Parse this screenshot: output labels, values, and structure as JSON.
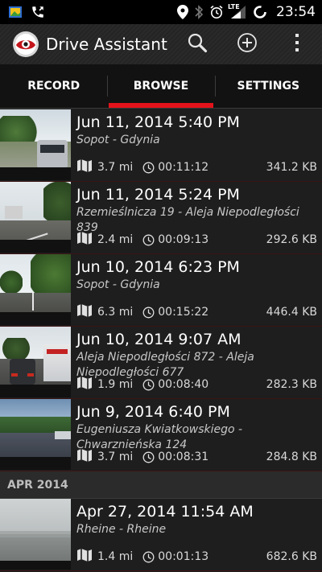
{
  "status_bar": {
    "time": "23:54",
    "left_icons": [
      "gallery-icon",
      "phone-icon"
    ],
    "right_icons": [
      "location-icon",
      "bluetooth-icon",
      "alarm-icon",
      "signal-lte-icon",
      "sync-icon"
    ],
    "lte_label": "LTE"
  },
  "app": {
    "title": "Drive Assistant",
    "actions": [
      "search-icon",
      "add-icon",
      "overflow-icon"
    ]
  },
  "tabs": [
    {
      "label": "RECORD",
      "active": false
    },
    {
      "label": "BROWSE",
      "active": true
    },
    {
      "label": "SETTINGS",
      "active": false
    }
  ],
  "recordings": [
    {
      "title": "Jun 11, 2014 5:40 PM",
      "route": "Sopot - Gdynia",
      "distance": "3.7 mi",
      "duration": "00:11:12",
      "size": "341.2 KB",
      "scene": "urban"
    },
    {
      "title": "Jun 11, 2014 5:24 PM",
      "route": "Rzemieślnicza 19 - Aleja Niepodległości 839",
      "distance": "2.4 mi",
      "duration": "00:09:13",
      "size": "292.6 KB",
      "scene": "suburb"
    },
    {
      "title": "Jun 10, 2014 6:23 PM",
      "route": "Sopot - Gdynia",
      "distance": "6.3 mi",
      "duration": "00:15:22",
      "size": "446.4 KB",
      "scene": "trees"
    },
    {
      "title": "Jun 10, 2014 9:07 AM",
      "route": "Aleja Niepodległości 872 - Aleja Niepodległości 677",
      "distance": "1.9 mi",
      "duration": "00:08:40",
      "size": "282.3 KB",
      "scene": "traffic"
    },
    {
      "title": "Jun 9, 2014 6:40 PM",
      "route": "Eugeniusza Kwiatkowskiego - Chwarznieńska 124",
      "distance": "3.7 mi",
      "duration": "00:08:31",
      "size": "284.8 KB",
      "scene": "highway"
    }
  ],
  "section_header": "APR 2014",
  "recordings_apr": [
    {
      "title": "Apr 27, 2014 11:54 AM",
      "route": "Rheine - Rheine",
      "distance": "1.4 mi",
      "duration": "00:01:13",
      "size": "682.6 KB",
      "scene": "rain"
    }
  ],
  "colors": {
    "accent": "#e4131b",
    "background": "#1e1e1e"
  }
}
